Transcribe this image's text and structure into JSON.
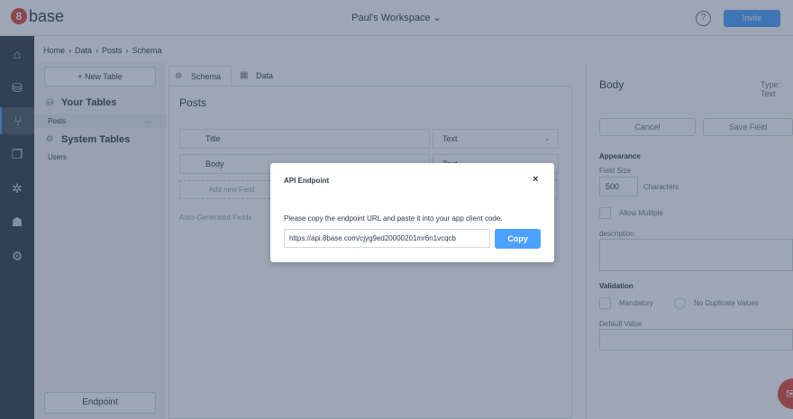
{
  "app": {
    "logo_mark": "8",
    "logo_text": "base",
    "workspace": "Paul's Workspace",
    "help_symbol": "?",
    "invite_label": "Invite"
  },
  "breadcrumb": [
    "Home",
    "›",
    "Data",
    "›",
    "Posts",
    "›",
    "Schema"
  ],
  "nav_icons": [
    "home-icon",
    "database-icon",
    "schema-icon",
    "cards-icon",
    "settings-gear-icon",
    "users-icon",
    "gear-icon"
  ],
  "tables_panel": {
    "new_table_label": "+ New Table",
    "your_tables_title": "Your Tables",
    "your_tables": [
      "Posts"
    ],
    "system_tables_title": "System Tables",
    "system_tables": [
      "Users"
    ],
    "more_symbol": "...",
    "endpoint_label": "Endpoint"
  },
  "tabs": [
    "Schema",
    "Data"
  ],
  "schema": {
    "table_name": "Posts",
    "fields": [
      {
        "name": "Title",
        "type": "Text"
      },
      {
        "name": "Body",
        "type": "Text"
      }
    ],
    "add_field_label": "Add new Field",
    "auto_generated_label": "Auto-Generated Fields"
  },
  "field_panel": {
    "title": "Body",
    "type_label": "Type: Text",
    "cancel_label": "Cancel",
    "save_label": "Save Field",
    "appearance_heading": "Appearance",
    "field_size_label": "Field Size",
    "field_size_value": "500",
    "characters_label": "Characters",
    "allow_multiple_label": "Allow Multiple",
    "description_label": "description",
    "validation_heading": "Validation",
    "mandatory_label": "Mandatory",
    "no_duplicates_label": "No Duplicate Values",
    "default_value_label": "Default Value"
  },
  "modal": {
    "title": "API Endpoint",
    "close_symbol": "×",
    "description": "Please copy the endpoint URL and paste it into your app client code.",
    "url": "https://api.8base.com/cjyg9ed20000201mr6n1vcqcb",
    "copy_label": "Copy"
  },
  "colors": {
    "accent": "#4da1ff",
    "brand": "#e2453a",
    "sidebar": "#323c47"
  }
}
